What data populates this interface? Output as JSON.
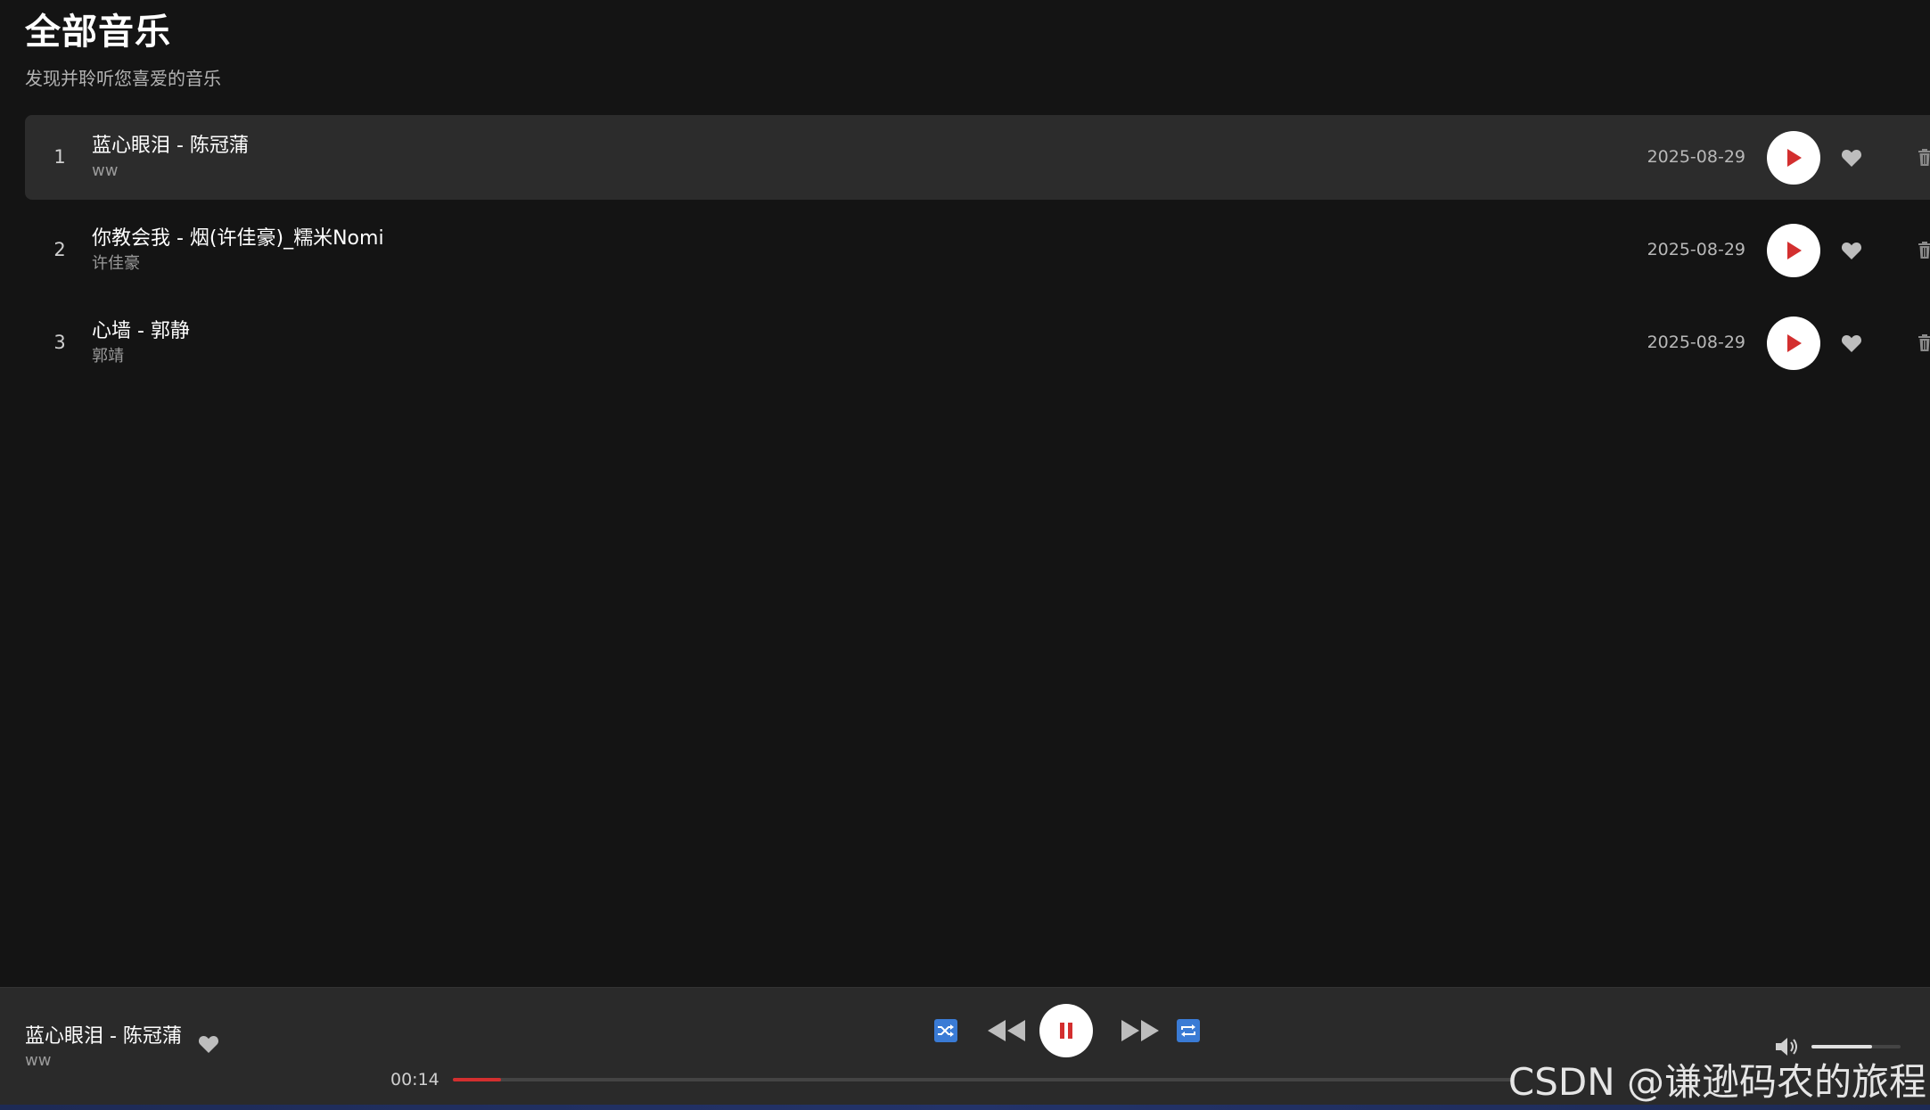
{
  "header": {
    "title": "全部音乐",
    "subtitle": "发现并聆听您喜爱的音乐"
  },
  "songs": [
    {
      "index": "1",
      "title": "蓝心眼泪 - 陈冠蒲",
      "artist": "ww",
      "date": "2025-08-29",
      "active": true
    },
    {
      "index": "2",
      "title": "你教会我 - 烟(许佳豪)_糯米Nomi",
      "artist": "许佳豪",
      "date": "2025-08-29",
      "active": false
    },
    {
      "index": "3",
      "title": "心墙 - 郭静",
      "artist": "郭靖",
      "date": "2025-08-29",
      "active": false
    }
  ],
  "player": {
    "title": "蓝心眼泪 - 陈冠蒲",
    "artist": "ww",
    "current_time": "00:14",
    "progress_fraction": 0.045,
    "volume_fraction": 0.68
  },
  "icons": {
    "play": "play-icon",
    "heart": "heart-icon",
    "trash": "trash-icon",
    "shuffle": "shuffle-icon",
    "prev": "previous-icon",
    "pause": "pause-icon",
    "next": "next-icon",
    "repeat": "repeat-icon",
    "volume": "volume-icon"
  },
  "colors": {
    "accent_red": "#d32f2f",
    "accent_blue": "#3a7bd5",
    "background": "#141414",
    "active_row": "#2c2c2c"
  },
  "watermark": "CSDN @谦逊码农的旅程"
}
